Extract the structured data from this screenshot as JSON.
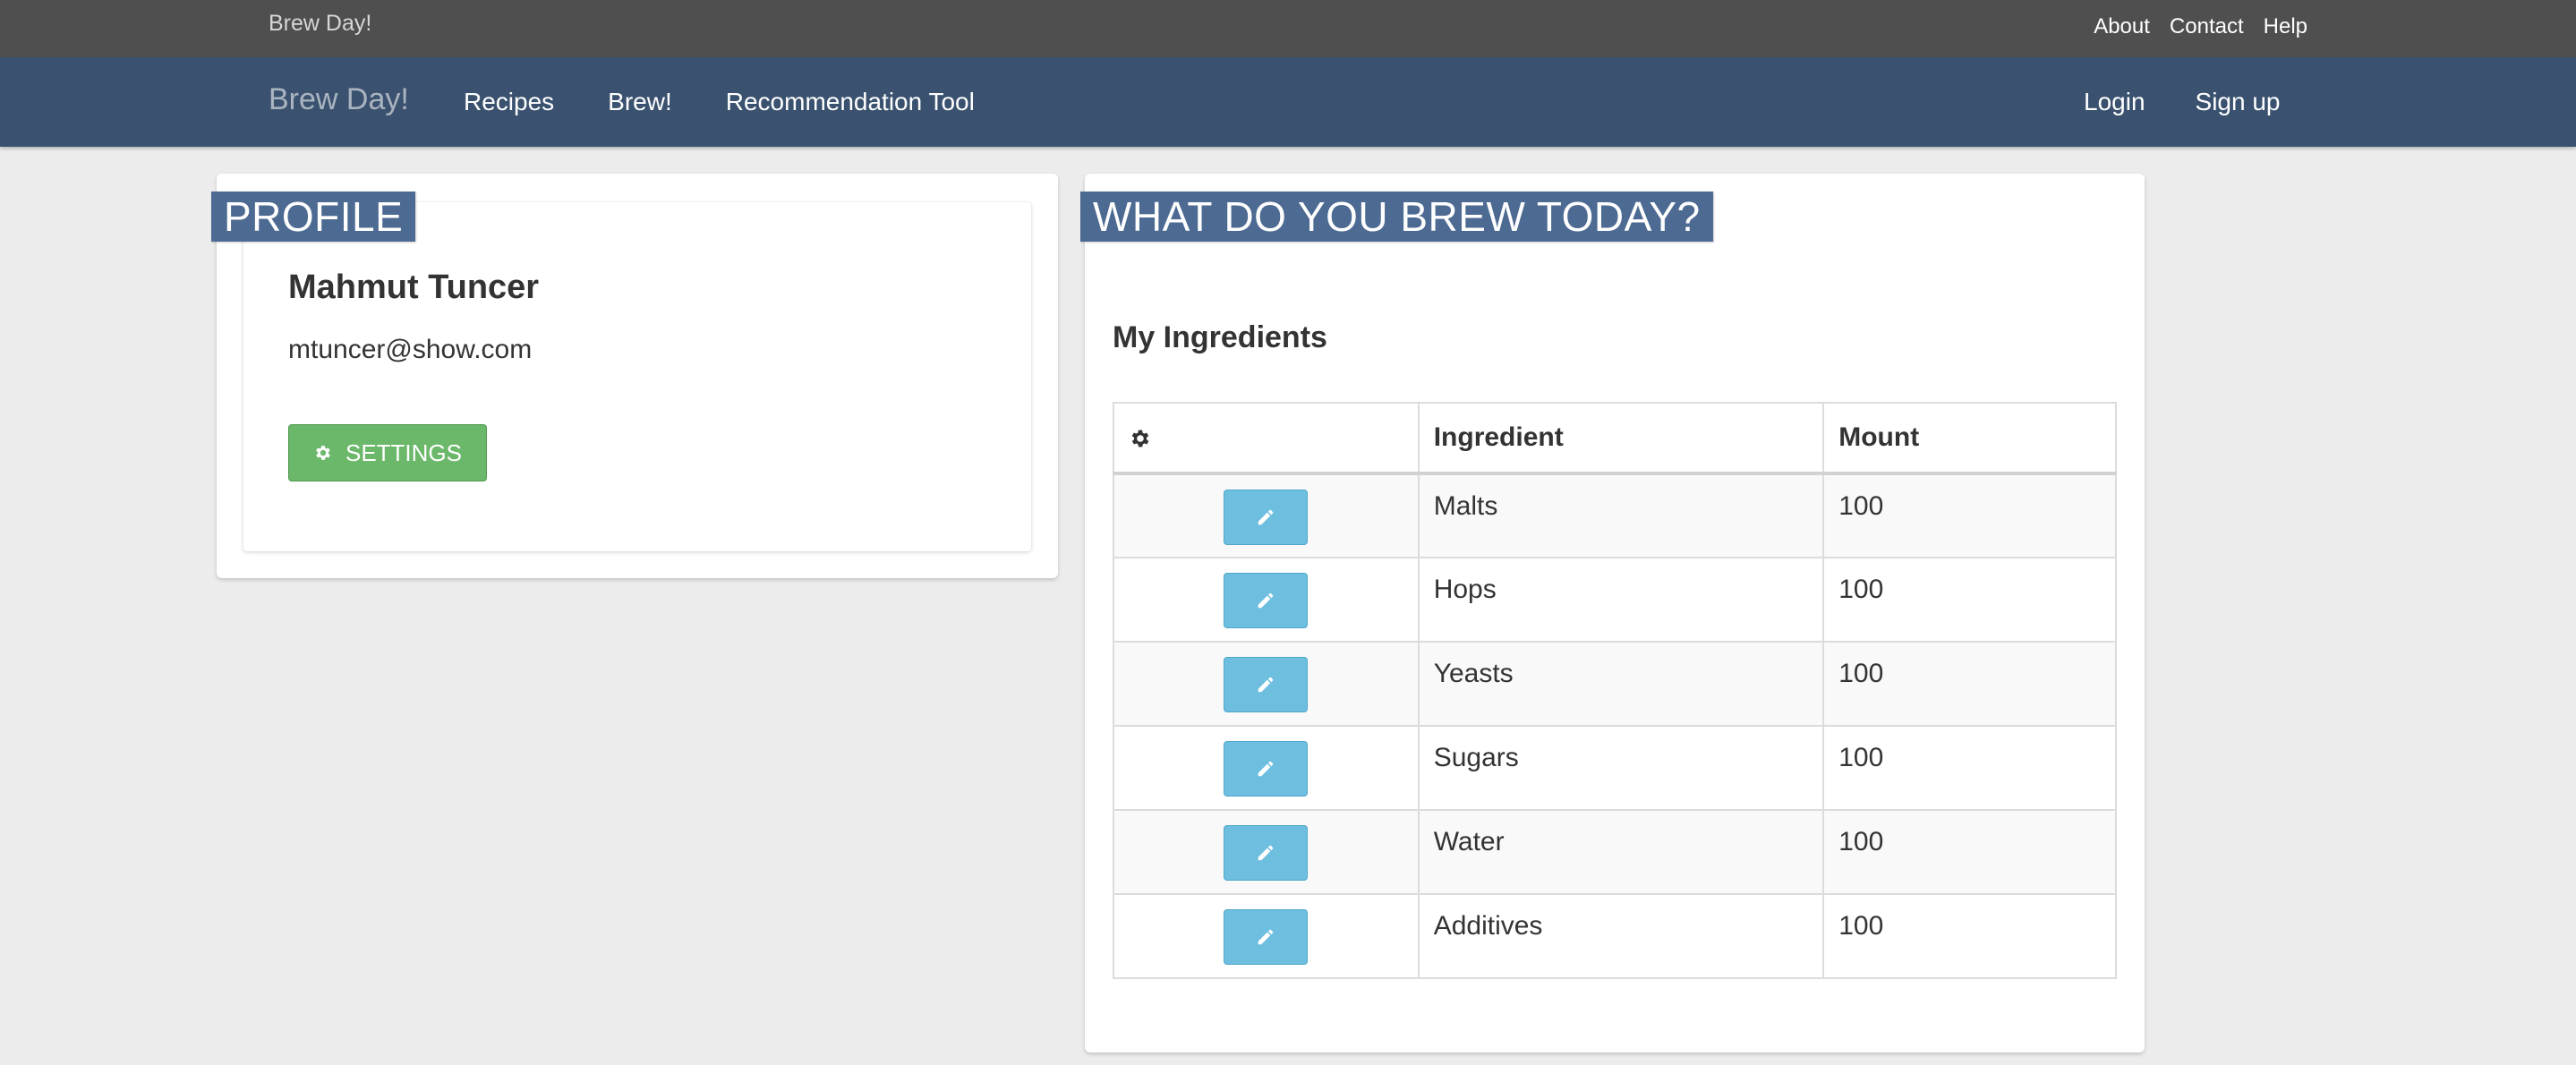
{
  "topbar": {
    "brand": "Brew Day!",
    "links": [
      "About",
      "Contact",
      "Help"
    ]
  },
  "navbar": {
    "brand": "Brew Day!",
    "items": [
      "Recipes",
      "Brew!",
      "Recommendation Tool"
    ],
    "right_items": [
      "Login",
      "Sign up"
    ]
  },
  "profile": {
    "section_label": "PROFILE",
    "name": "Mahmut Tuncer",
    "email": "mtuncer@show.com",
    "settings_label": "SETTINGS"
  },
  "brew": {
    "section_label": "WHAT DO YOU BREW TODAY?",
    "ingredients_title": "My Ingredients",
    "columns": [
      "",
      "Ingredient",
      "Mount"
    ],
    "rows": [
      {
        "ingredient": "Malts",
        "mount": "100"
      },
      {
        "ingredient": "Hops",
        "mount": "100"
      },
      {
        "ingredient": "Yeasts",
        "mount": "100"
      },
      {
        "ingredient": "Sugars",
        "mount": "100"
      },
      {
        "ingredient": "Water",
        "mount": "100"
      },
      {
        "ingredient": "Additives",
        "mount": "100"
      }
    ]
  },
  "icons": {
    "settings": "gear-icon",
    "edit": "pencil-icon",
    "table_header": "gear-icon"
  },
  "colors": {
    "topbar": "#4f4f4f",
    "navbar": "#3a526f",
    "section_label": "#4d6a92",
    "settings_button": "#6cb86a",
    "edit_button": "#6ebfdf"
  }
}
